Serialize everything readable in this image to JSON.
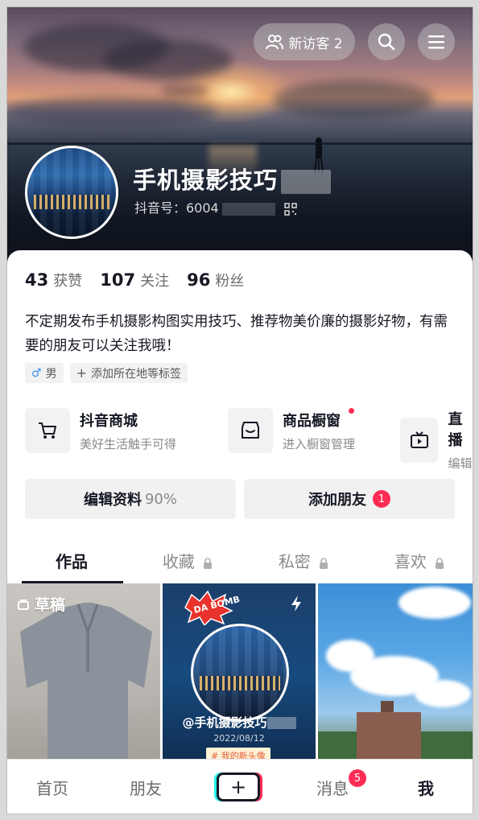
{
  "header": {
    "visitor_label": "新访客 2",
    "display_name": "手机摄影技巧",
    "douyin_id": "抖音号：6004"
  },
  "stats": [
    {
      "num": "43",
      "label": "获赞"
    },
    {
      "num": "107",
      "label": "关注"
    },
    {
      "num": "96",
      "label": "粉丝"
    }
  ],
  "bio": "不定期发布手机摄影构图实用技巧、推荐物美价廉的摄影好物，有需要的朋友可以关注我哦！",
  "tags": {
    "gender": "男",
    "add_label": "添加所在地等标签"
  },
  "services": [
    {
      "title": "抖音商城",
      "subtitle": "美好生活触手可得",
      "icon": "cart-icon"
    },
    {
      "title": "商品橱窗",
      "subtitle": "进入橱窗管理",
      "icon": "shop-icon",
      "dot": true
    },
    {
      "title": "直播",
      "subtitle": "编辑",
      "icon": "tv-icon"
    }
  ],
  "actions": {
    "edit_label": "编辑资料",
    "edit_progress": "90%",
    "add_friend_label": "添加朋友",
    "add_friend_badge": "1"
  },
  "tabs": [
    {
      "label": "作品",
      "active": true
    },
    {
      "label": "收藏",
      "locked": true
    },
    {
      "label": "私密",
      "locked": true
    },
    {
      "label": "喜欢",
      "locked": true
    }
  ],
  "grid": {
    "draft_label": "草稿",
    "bomb_text": "DA BOMB",
    "video_handle": "@手机摄影技巧",
    "video_date": "2022/08/12",
    "video_tag": "# 我的新头像"
  },
  "bottom_nav": {
    "home": "首页",
    "friends": "朋友",
    "plus": "+",
    "messages": "消息",
    "messages_badge": "5",
    "me": "我"
  },
  "colors": {
    "accent_red": "#fe2c55",
    "text_primary": "#161823",
    "text_secondary": "#8a8a8a"
  }
}
